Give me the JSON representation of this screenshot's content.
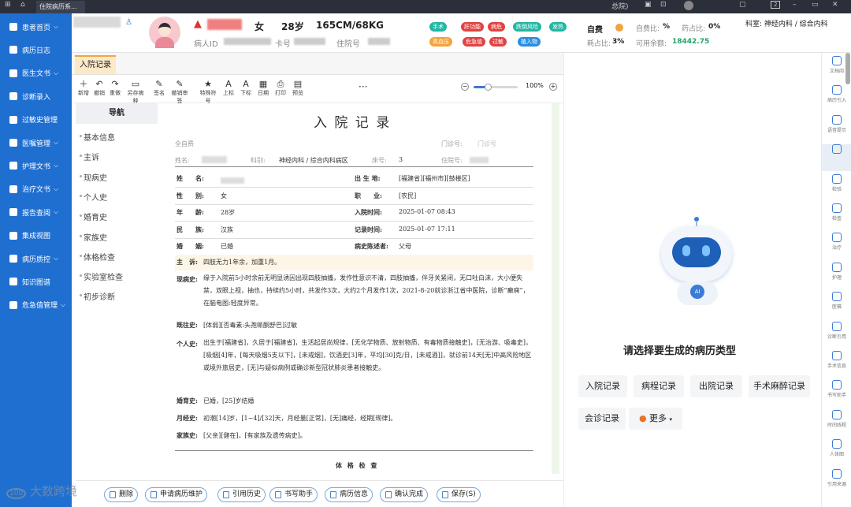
{
  "titlebar": {
    "tab": "住院病历系...",
    "right_label": "总院)",
    "page_num": "2"
  },
  "sidebar": {
    "items": [
      {
        "label": "患者首页",
        "arrow": "⌵"
      },
      {
        "label": "病历日志",
        "arrow": ""
      },
      {
        "label": "医生文书",
        "arrow": "⌵"
      },
      {
        "label": "诊断录入",
        "arrow": ""
      },
      {
        "label": "过敏史管理",
        "arrow": ""
      },
      {
        "label": "医嘱管理",
        "arrow": "⌵"
      },
      {
        "label": "护理文书",
        "arrow": "⌵"
      },
      {
        "label": "治疗文书",
        "arrow": "⌵"
      },
      {
        "label": "报告查阅",
        "arrow": "⌵"
      },
      {
        "label": "集成视图",
        "arrow": ""
      },
      {
        "label": "病历质控",
        "arrow": "⌵"
      },
      {
        "label": "知识图谱",
        "arrow": ""
      },
      {
        "label": "危急值管理",
        "arrow": "⌵"
      }
    ]
  },
  "patient": {
    "gender": "女",
    "age": "28岁",
    "height_weight": "165CM/68KG",
    "id_label": "病人ID",
    "card_label": "卡号",
    "inpatient_label": "住院号",
    "tags": [
      {
        "label": "手术",
        "color": "#23b7a3"
      },
      {
        "label": "肝功能",
        "color": "#e04343"
      },
      {
        "label": "病危",
        "color": "#e04343"
      },
      {
        "label": "跌倒风险",
        "color": "#23b7a3"
      },
      {
        "label": "发热",
        "color": "#23b7a3"
      },
      {
        "label": "高血压",
        "color": "#f2a33a"
      },
      {
        "label": "危急值",
        "color": "#e04343"
      },
      {
        "label": "过敏",
        "color": "#e04343"
      },
      {
        "label": "植入物",
        "color": "#2b8de0"
      }
    ],
    "pay_type": "自费",
    "self_pay_ratio_label": "自费比:",
    "self_pay_ratio": "%",
    "drug_ratio_label": "药占比:",
    "drug_ratio": "0%",
    "consumable_label": "耗占比:",
    "consumable": "3%",
    "balance_label": "可用余额:",
    "balance": "18442.75",
    "dept": "科室: 神经内科 / 综合内科"
  },
  "tab": {
    "label": "入院记录"
  },
  "toolbar": {
    "tools": [
      {
        "g": "＋",
        "l": "新增"
      },
      {
        "g": "↶",
        "l": "撤销"
      },
      {
        "g": "↷",
        "l": "重做"
      },
      {
        "g": "▭",
        "l": "另存病种"
      },
      {
        "g": "✎",
        "l": "签名"
      },
      {
        "g": "✎",
        "l": "撤销审签"
      },
      {
        "g": "★",
        "l": "特殊符号"
      },
      {
        "g": "A",
        "l": "上标"
      },
      {
        "g": "A",
        "l": "下标"
      },
      {
        "g": "▦",
        "l": "日期"
      },
      {
        "g": "⎙",
        "l": "打印"
      },
      {
        "g": "▤",
        "l": "预览"
      }
    ],
    "more": "···",
    "zoom": "100%"
  },
  "nav": {
    "title": "导航",
    "items": [
      "基本信息",
      "主诉",
      "现病史",
      "个人史",
      "婚育史",
      "家族史",
      "体格检查",
      "实验室检查",
      "初步诊断"
    ]
  },
  "doc": {
    "title": "入 院 记 录",
    "hospital": "全自费",
    "outpatient_label": "门诊号:",
    "outpatient_val": "门诊号",
    "name_label": "姓名:",
    "dept_label": "科别:",
    "dept_val": "神经内科 / 综合内科病区",
    "bed_label": "床号:",
    "bed_val": "3",
    "inpatient_label": "住院号:",
    "fields": [
      {
        "k": "姓　　名:",
        "v": ""
      },
      {
        "k": "出 生 地:",
        "v": "[福建省][福州市][鼓楼区]"
      },
      {
        "k": "性　　别:",
        "v": "女"
      },
      {
        "k": "职　　业:",
        "v": "[农民]"
      },
      {
        "k": "年　　龄:",
        "v": "28岁"
      },
      {
        "k": "入院时间:",
        "v": "2025-01-07 08:43"
      },
      {
        "k": "民　　族:",
        "v": "汉族"
      },
      {
        "k": "记录时间:",
        "v": "2025-01-07 17:11"
      },
      {
        "k": "婚　　姻:",
        "v": "已婚"
      },
      {
        "k": "病史陈述者:",
        "v": "父母"
      }
    ],
    "complaint_label": "主　诉:",
    "complaint": "四肢无力1年余，加重1月。",
    "hpi_label": "现病史:",
    "hpi": "缘于入院前5小时余前无明显诱因出现四肢抽搐，发作性意识不清，四肢抽搐，伴牙关紧闭，无口吐白沫，大小便失禁，双眼上视，抽也，持续约5小时，共发作3次，大约2个月发作1次，2021-8-20就诊浙江省中医院，诊断“癫痫”，在脑电图:轻度异常。",
    "past_label": "既往史:",
    "past": "[体弱][否毒素:头孢哌酮舒巴]过敏",
    "personal_label": "个人史:",
    "personal": "出生于[福建省]，久居于[福建省]，生活起居尚规律，[无化学物质、放射物质、有毒物质接触史]，[无治游、吸毒史]，[吸烟[4]年，[每天吸烟5支以下]，[未戒烟]，饮酒史[3]年，平均[30]克/日，[未戒酒]]，就诊前14天[无]中高风险地区或境外旅居史，[无]与疑似病例或确诊新型冠状肺炎患者接触史。",
    "marital_label": "婚育史:",
    "marital": "已婚，[25]岁结婚",
    "menstrual_label": "月经史:",
    "menstrual": "初潮[14]岁，[1~4]/[32]天，月经量[正常]，[无]痛经，经期[规律]。",
    "family_label": "家族史:",
    "family": "[父亲][健在]，[有家族及遗传病史]。",
    "exam_title": "体 格 检 查"
  },
  "bottom": {
    "buttons": [
      "删除",
      "申请病历维护",
      "引用历史",
      "书写助手",
      "病历信息",
      "确认完成",
      "保存(S)"
    ],
    "watermark": "大数跨境"
  },
  "ai": {
    "prompt": "请选择要生成的病历类型",
    "options": [
      "入院记录",
      "病程记录",
      "出院记录",
      "手术麻醉记录",
      "会诊记录"
    ],
    "more": "更多",
    "bot_label": "AI"
  },
  "rstrip": {
    "items": [
      "文档阅",
      "病历引入",
      "语音提示",
      "",
      "检验",
      "检查",
      "治疗",
      "护理",
      "医嘱",
      "诊断引用",
      "手术信息",
      "书写助手",
      "时间线程",
      "人体图",
      "引用来源"
    ]
  }
}
